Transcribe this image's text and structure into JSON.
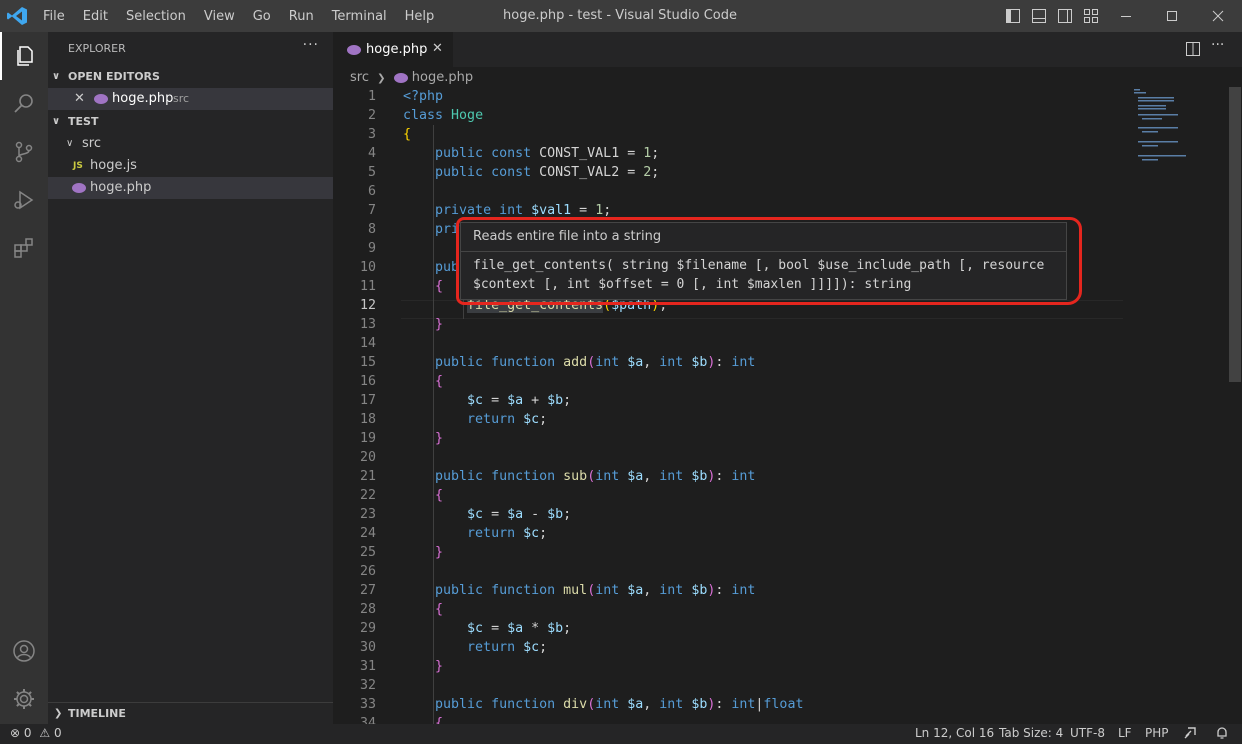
{
  "window": {
    "title": "hoge.php - test - Visual Studio Code",
    "menu": [
      "File",
      "Edit",
      "Selection",
      "View",
      "Go",
      "Run",
      "Terminal",
      "Help"
    ]
  },
  "sidebar": {
    "title": "EXPLORER",
    "more": "···",
    "open_editors": {
      "header": "OPEN EDITORS",
      "items": [
        {
          "name": "hoge.php",
          "desc": "src"
        }
      ]
    },
    "workspace": {
      "header": "TEST",
      "folder": "src",
      "files": [
        {
          "name": "hoge.js",
          "badge": "JS"
        },
        {
          "name": "hoge.php"
        }
      ]
    },
    "timeline": "TIMELINE"
  },
  "editor": {
    "tab": {
      "name": "hoge.php"
    },
    "breadcrumb": {
      "folder": "src",
      "file": "hoge.php"
    },
    "line_numbers": [
      "1",
      "2",
      "3",
      "4",
      "5",
      "6",
      "7",
      "8",
      "9",
      "10",
      "11",
      "12",
      "13",
      "14",
      "15",
      "16",
      "17",
      "18",
      "19",
      "20",
      "21",
      "22",
      "23",
      "24",
      "25",
      "26",
      "27",
      "28",
      "29",
      "30",
      "31",
      "32",
      "33",
      "34"
    ],
    "current_line": "12"
  },
  "hover": {
    "summary": "Reads entire file into a string",
    "signature_line1": "file_get_contents( string $filename [, bool $use_include_path [, resource",
    "signature_line2": "$context [, int $offset = 0 [, int $maxlen ]]]]): string"
  },
  "statusbar": {
    "errors": "0",
    "warnings": "0",
    "position": "Ln 12, Col 16",
    "tab_size": "Tab Size: 4",
    "encoding": "UTF-8",
    "eol": "LF",
    "language": "PHP"
  },
  "colors": {
    "accent_annotation": "#e5261e",
    "keyword": "#569cd6",
    "type": "#4ec9b0",
    "function": "#dcdcaa",
    "variable": "#9cdcfe",
    "number": "#b5cea8"
  }
}
